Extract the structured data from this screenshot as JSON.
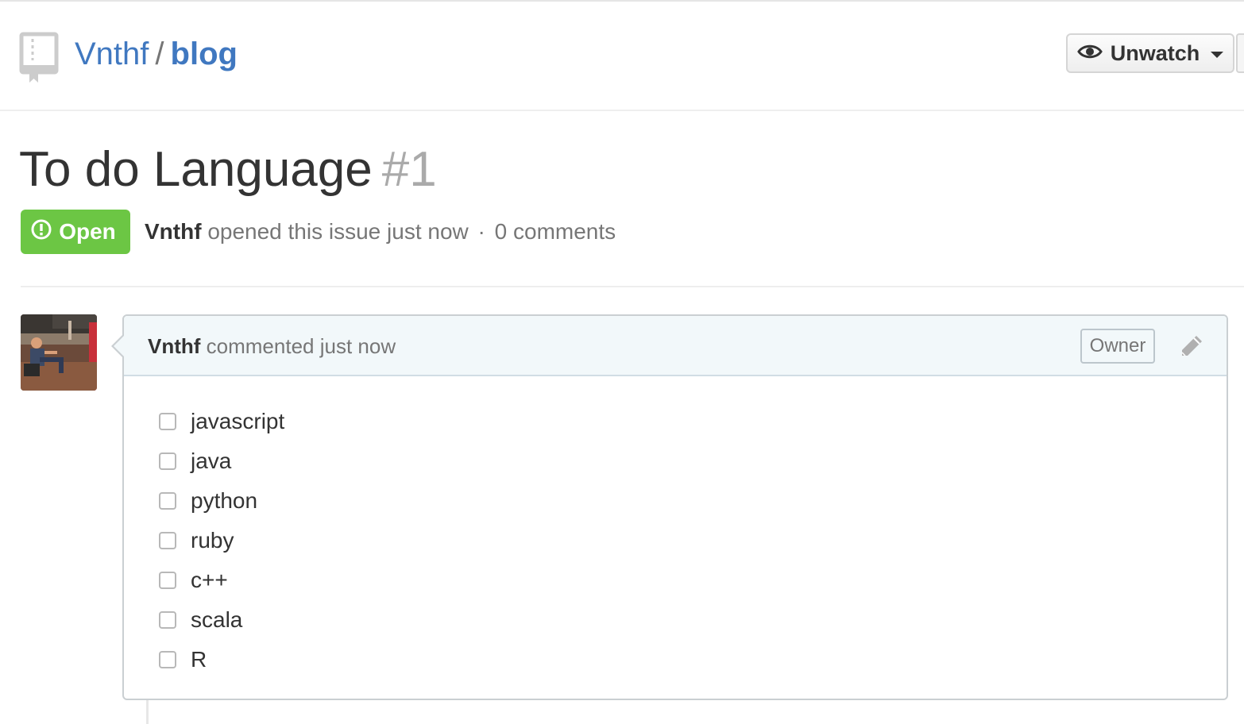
{
  "repo": {
    "owner": "Vnthf",
    "separator": "/",
    "name": "blog"
  },
  "watch": {
    "label": "Unwatch"
  },
  "issue": {
    "title": "To do Language",
    "number": "#1",
    "state": "Open",
    "state_color": "#6cc644",
    "author": "Vnthf",
    "opened_text": "opened this issue just now",
    "separator": "·",
    "comments": "0 comments"
  },
  "comment": {
    "author": "Vnthf",
    "action_text": "commented just now",
    "role_label": "Owner",
    "tasks": [
      {
        "label": "javascript",
        "checked": false
      },
      {
        "label": "java",
        "checked": false
      },
      {
        "label": "python",
        "checked": false
      },
      {
        "label": "ruby",
        "checked": false
      },
      {
        "label": "c++",
        "checked": false
      },
      {
        "label": "scala",
        "checked": false
      },
      {
        "label": "R",
        "checked": false
      }
    ]
  },
  "icons": {
    "repo": "repo-icon",
    "watch": "eye-icon",
    "state": "issue-opened-icon",
    "edit": "pencil-icon",
    "avatar": "avatar"
  },
  "colors": {
    "link": "#4078c0",
    "open": "#6cc644",
    "comment_header_bg": "#f2f8fa"
  }
}
